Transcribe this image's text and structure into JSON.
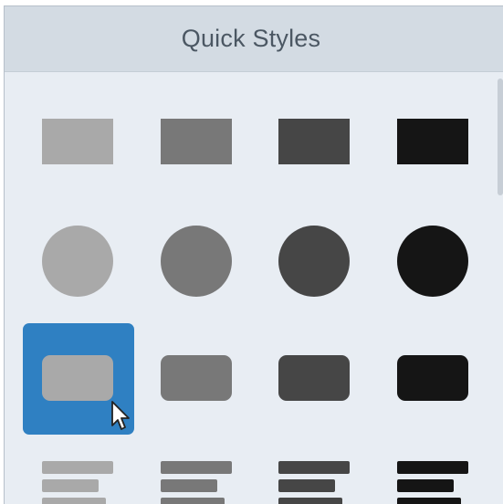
{
  "panel": {
    "title": "Quick Styles"
  },
  "colors": {
    "panel_bg": "#e8edf3",
    "header_bg": "#d3dbe3",
    "title_text": "#4b5763",
    "selection": "#2f80c2",
    "shade_1": "#a9a9a9",
    "shade_2": "#787878",
    "shade_3": "#464646",
    "shade_4": "#151515"
  },
  "styles": {
    "rows": [
      {
        "shape": "rectangle",
        "items": [
          "light-gray",
          "medium-gray",
          "dark-gray",
          "black"
        ]
      },
      {
        "shape": "circle",
        "items": [
          "light-gray",
          "medium-gray",
          "dark-gray",
          "black"
        ]
      },
      {
        "shape": "rounded-rectangle",
        "items": [
          "light-gray",
          "medium-gray",
          "dark-gray",
          "black"
        ],
        "selected_index": 0
      },
      {
        "shape": "text-lines",
        "items": [
          "light-gray",
          "medium-gray",
          "dark-gray",
          "black"
        ]
      }
    ]
  },
  "cursor": {
    "icon": "mouse-pointer-icon"
  }
}
